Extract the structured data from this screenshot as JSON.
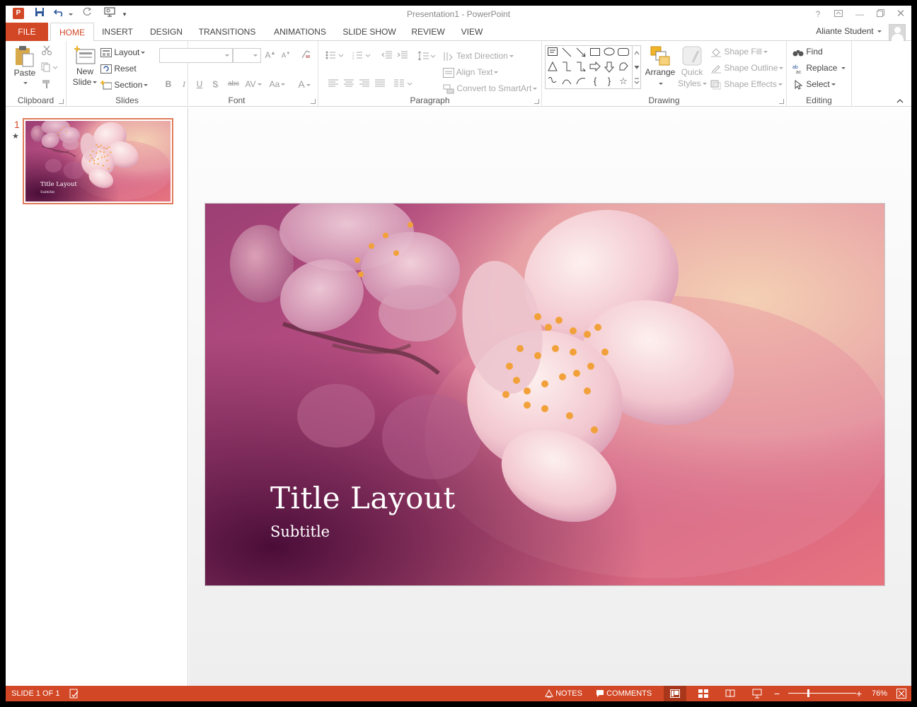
{
  "window": {
    "title": "Presentation1 - PowerPoint",
    "app_badge": "P"
  },
  "qat": {
    "save_icon": "save-icon",
    "undo_icon": "undo-icon",
    "redo_icon": "redo-icon",
    "start_icon": "start-from-beginning-icon"
  },
  "tabs": [
    {
      "label": "FILE"
    },
    {
      "label": "HOME"
    },
    {
      "label": "INSERT"
    },
    {
      "label": "DESIGN"
    },
    {
      "label": "TRANSITIONS"
    },
    {
      "label": "ANIMATIONS"
    },
    {
      "label": "SLIDE SHOW"
    },
    {
      "label": "REVIEW"
    },
    {
      "label": "VIEW"
    }
  ],
  "user": {
    "name": "Aliante Student"
  },
  "ribbon": {
    "clipboard": {
      "label": "Clipboard",
      "paste": "Paste"
    },
    "slides": {
      "label": "Slides",
      "new_slide_1": "New",
      "new_slide_2": "Slide",
      "layout": "Layout",
      "reset": "Reset",
      "section": "Section"
    },
    "font": {
      "label": "Font",
      "bold": "B",
      "italic": "I",
      "underline": "U",
      "shadow": "S",
      "strike": "abc",
      "spacing": "AV",
      "case": "Aa",
      "grow": "A",
      "shrink": "A",
      "color": "A"
    },
    "paragraph": {
      "label": "Paragraph",
      "text_direction": "Text Direction",
      "align_text": "Align Text",
      "smartart": "Convert to SmartArt"
    },
    "drawing": {
      "label": "Drawing",
      "arrange": "Arrange",
      "quick_styles_1": "Quick",
      "quick_styles_2": "Styles",
      "shape_fill": "Shape Fill",
      "shape_outline": "Shape Outline",
      "shape_effects": "Shape Effects"
    },
    "editing": {
      "label": "Editing",
      "find": "Find",
      "replace": "Replace",
      "select": "Select"
    }
  },
  "thumbnails": [
    {
      "number": "1",
      "title": "Title Layout",
      "subtitle": "Subtitle"
    }
  ],
  "slide": {
    "title": "Title Layout",
    "subtitle": "Subtitle"
  },
  "status": {
    "slide_info": "SLIDE 1 OF 1",
    "notes": "NOTES",
    "comments": "COMMENTS",
    "zoom": "76%"
  },
  "colors": {
    "accent": "#d24726",
    "status_bar": "#d24726"
  }
}
